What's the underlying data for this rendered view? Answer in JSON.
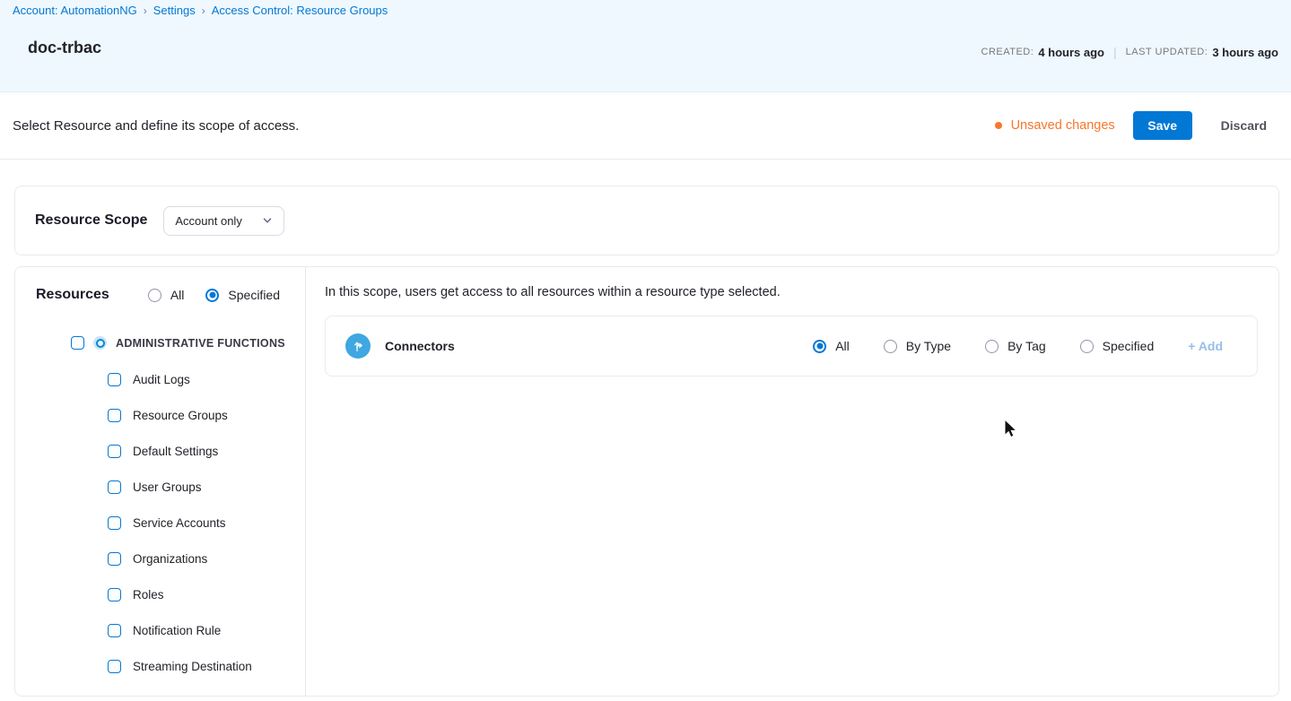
{
  "breadcrumb": {
    "separator": "›",
    "items": [
      "Account: AutomationNG",
      "Settings",
      "Access Control: Resource Groups"
    ]
  },
  "header": {
    "title": "doc-trbac",
    "created_label": "CREATED:",
    "created_value": "4 hours ago",
    "updated_label": "LAST UPDATED:",
    "updated_value": "3 hours ago",
    "meta_separator": "|"
  },
  "toolbar": {
    "message": "Select Resource and define its scope of access.",
    "unsaved_label": "Unsaved changes",
    "save_label": "Save",
    "discard_label": "Discard"
  },
  "resource_scope": {
    "label": "Resource Scope",
    "selected_option": "Account only",
    "dropdown_icon": "chevron-down-icon"
  },
  "resources_panel": {
    "heading": "Resources",
    "options": [
      {
        "label": "All",
        "selected": false
      },
      {
        "label": "Specified",
        "selected": true
      }
    ],
    "group": {
      "label": "ADMINISTRATIVE FUNCTIONS",
      "checked": false,
      "badge_icon": "scope-dot-icon"
    },
    "items": [
      "Audit Logs",
      "Resource Groups",
      "Default Settings",
      "User Groups",
      "Service Accounts",
      "Organizations",
      "Roles",
      "Notification Rule",
      "Streaming Destination"
    ]
  },
  "main": {
    "instruction": "In this scope, users get access to all resources within a resource type selected.",
    "resource_row": {
      "icon": "connectors-icon",
      "label": "Connectors",
      "options": [
        {
          "label": "All",
          "selected": true
        },
        {
          "label": "By Type",
          "selected": false
        },
        {
          "label": "By Tag",
          "selected": false
        },
        {
          "label": "Specified",
          "selected": false
        }
      ],
      "add_label": "+ Add"
    }
  },
  "colors": {
    "accent_blue": "#0278D5",
    "header_bg": "#EFF8FE",
    "unsaved_orange": "#F8762C",
    "connectors_icon_blue": "#3FA7E1",
    "add_link_blue": "#97BEEA"
  }
}
